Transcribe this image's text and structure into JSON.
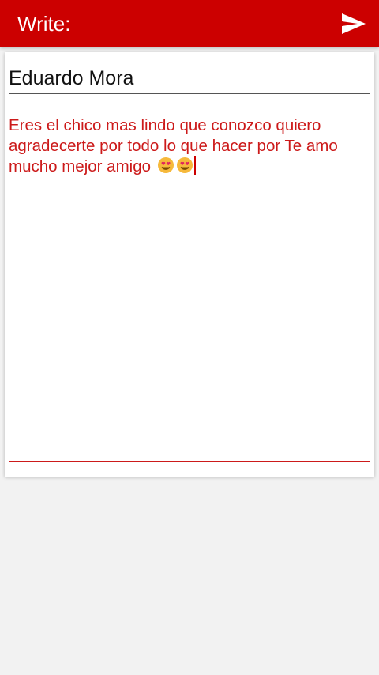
{
  "appbar": {
    "title": "Write:",
    "send_icon": "send-icon",
    "color": "#cc0000"
  },
  "form": {
    "recipient_name": "Eduardo Mora",
    "message": "Eres el chico mas lindo que conozco quiero agradecerte por todo lo que hacer por Te amo mucho mejor amigo",
    "emojis": [
      "heart-eyes-face-icon",
      "heart-eyes-face-icon"
    ],
    "accent_color": "#cc1a1a"
  }
}
